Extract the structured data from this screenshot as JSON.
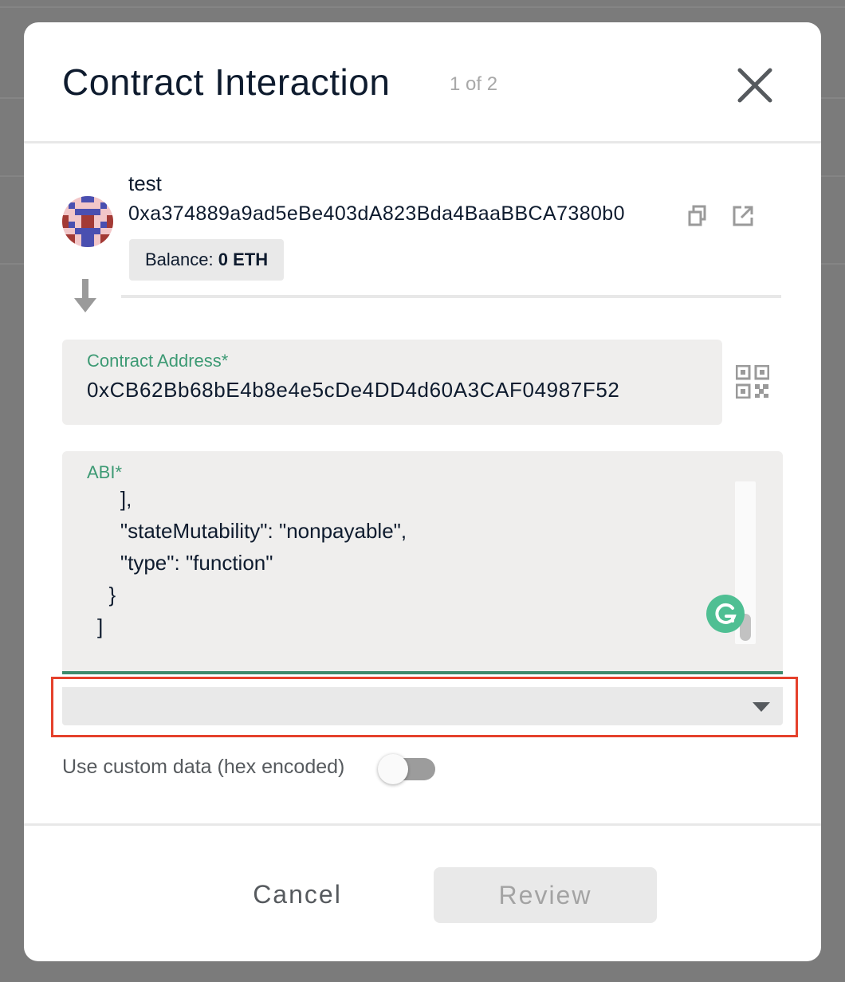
{
  "modal": {
    "title": "Contract Interaction",
    "step": "1 of 2",
    "close_icon": "close-icon"
  },
  "sender": {
    "name": "test",
    "address": "0xa374889a9ad5eBe403dA823Bda4BaaBBCA7380b0",
    "balance_label": "Balance:",
    "balance_value": "0 ETH",
    "icons": [
      "copy-icon",
      "external-link-icon",
      "arrow-down-icon"
    ]
  },
  "contract": {
    "label": "Contract Address*",
    "value": "0xCB62Bb68bE4b8e4e5cDe4DD4d60A3CAF04987F52",
    "icon": "qr-code-icon"
  },
  "abi": {
    "label": "ABI*",
    "text": "    ],\n    \"stateMutability\": \"nonpayable\",\n    \"type\": \"function\"\n  }\n]"
  },
  "function_select": {
    "value": "",
    "icon": "caret-down-icon"
  },
  "custom_data": {
    "label": "Use custom data (hex encoded)",
    "enabled": false
  },
  "footer": {
    "cancel_label": "Cancel",
    "review_label": "Review"
  },
  "colors": {
    "accent_green": "#3d9a74",
    "highlight_red": "#e5412c",
    "title": "#0e1b2e"
  }
}
